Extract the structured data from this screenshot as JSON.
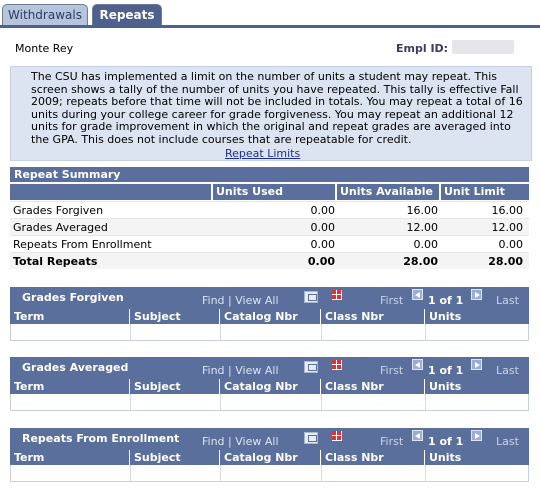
{
  "tabs": [
    {
      "label": "Withdrawals",
      "active": false
    },
    {
      "label": "Repeats",
      "active": true
    }
  ],
  "student": {
    "name": "Monte Rey",
    "empl_id_label": "Empl ID:"
  },
  "notice": {
    "text": "The CSU has implemented a limit on the number of units a student may repeat. This screen shows a tally of the number of units you have repeated. This tally is effective Fall 2009; repeats before that time will not be included in totals. You may repeat a total of 16 units during your college career for grade forgiveness. You may repeat an additional 12 units for grade improvement in which the original and repeat grades are averaged into the GPA. This does not include courses that are repeatable for credit.",
    "link": "Repeat Limits"
  },
  "summary": {
    "title": "Repeat Summary",
    "headers": [
      "",
      "Units Used",
      "Units Available",
      "Unit Limit"
    ],
    "rows": [
      {
        "label": "Grades Forgiven",
        "used": "0.00",
        "available": "16.00",
        "limit": "16.00"
      },
      {
        "label": "Grades Averaged",
        "used": "0.00",
        "available": "12.00",
        "limit": "12.00"
      },
      {
        "label": "Repeats From Enrollment",
        "used": "0.00",
        "available": "0.00",
        "limit": "0.00"
      },
      {
        "label": "Total Repeats",
        "used": "0.00",
        "available": "28.00",
        "limit": "28.00"
      }
    ]
  },
  "grid_nav": {
    "find": "Find",
    "sep": "|",
    "view_all": "View All",
    "first": "First",
    "of": "1 of 1",
    "last": "Last"
  },
  "grids": [
    {
      "title": "Grades Forgiven"
    },
    {
      "title": "Grades Averaged"
    },
    {
      "title": "Repeats From Enrollment"
    }
  ],
  "grid_columns": [
    "Term",
    "Subject",
    "Catalog Nbr",
    "Class Nbr",
    "Units"
  ],
  "colors": {
    "header": "#5a6f9c",
    "tab_active": "#4e608c",
    "notice_bg": "#dde4f1",
    "link": "#1f2f8f"
  }
}
